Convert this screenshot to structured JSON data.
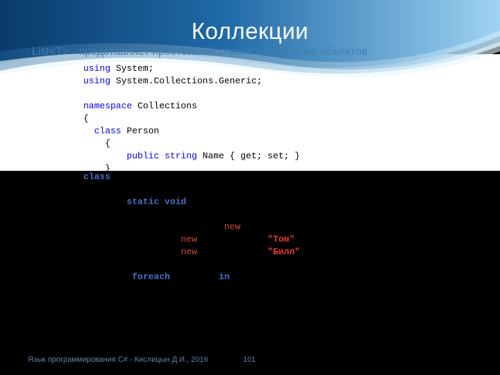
{
  "title": "Коллекции",
  "subtitle": "List<T> - представляет простейший список однотипных объектов",
  "code_top": {
    "l1a": "using",
    "l1b": " System;",
    "l2a": "using",
    "l2b": " System.Collections.Generic;",
    "l3a": "namespace",
    "l3b": " Collections",
    "l4": "{",
    "l5a": "  class",
    "l5b": " Person",
    "l6": "    {",
    "l7a": "        public string",
    "l7b": " Name { get; set; }",
    "l8": "    }"
  },
  "code_bot": {
    "l1": "class",
    "l2": "static void",
    "l3": "new",
    "l4a": "new",
    "l4b": "\"Том\"",
    "l5a": "new",
    "l5b": "\"Билл\"",
    "l6a": "foreach",
    "l6b": "in"
  },
  "footer": "Язык программирования C# - Кислицын Д.И., 2016",
  "page_num": "101"
}
